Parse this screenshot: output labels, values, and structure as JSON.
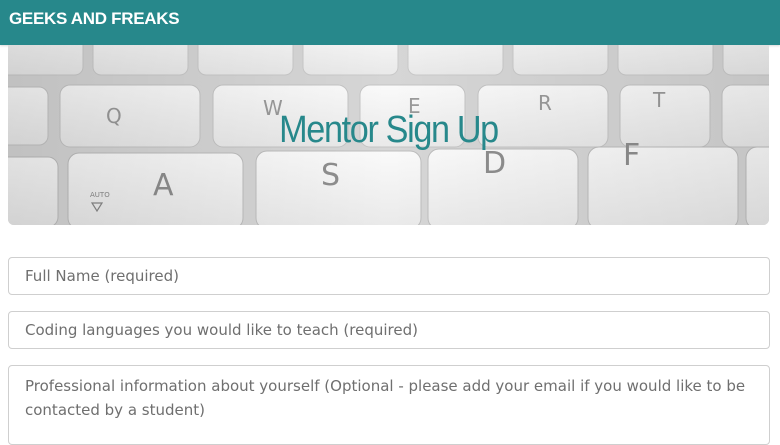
{
  "navbar": {
    "brand": "GEEKS AND FREAKS",
    "brand_color": "#27888b"
  },
  "hero": {
    "title": "Mentor Sign Up",
    "title_color": "#27888b",
    "keycaps": [
      "Q",
      "W",
      "E",
      "R",
      "T",
      "A",
      "S",
      "D",
      "F",
      "AUTO"
    ]
  },
  "form": {
    "full_name": {
      "value": "",
      "placeholder": "Full Name (required)"
    },
    "languages": {
      "value": "",
      "placeholder": "Coding languages you would like to teach (required)"
    },
    "professional": {
      "value": "",
      "placeholder": "Professional information about yourself (Optional - please add your email if you would like to be contacted by a student)"
    }
  }
}
